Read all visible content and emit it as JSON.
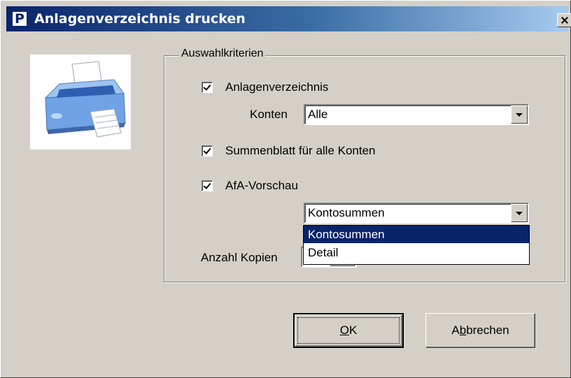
{
  "window": {
    "title": "Anlagenverzeichnis drucken",
    "app_icon_letter": "P"
  },
  "illustration": {
    "icon": "printer-icon"
  },
  "group": {
    "legend": "Auswahlkriterien"
  },
  "anlagenverzeichnis": {
    "label": "Anlagenverzeichnis",
    "checked": true
  },
  "konten": {
    "label": "Konten",
    "value": "Alle"
  },
  "summenblatt": {
    "label": "Summenblatt  für alle Konten",
    "checked": true
  },
  "afa_vorschau": {
    "label": "AfA-Vorschau",
    "checked": true
  },
  "afa_mode": {
    "value": "Kontosummen",
    "options": [
      "Kontosummen",
      "Detail"
    ],
    "highlighted_option": "Kontosummen"
  },
  "kopien": {
    "label": "Anzahl Kopien"
  },
  "buttons": {
    "ok": {
      "mnemonic": "O",
      "rest": "K"
    },
    "cancel": {
      "pre": "A",
      "mnemonic": "b",
      "rest": "brechen"
    }
  },
  "colors": {
    "face": "#d4d0c8",
    "title_start": "#0a246a",
    "title_end": "#a6caf0",
    "selection": "#0a246a"
  }
}
